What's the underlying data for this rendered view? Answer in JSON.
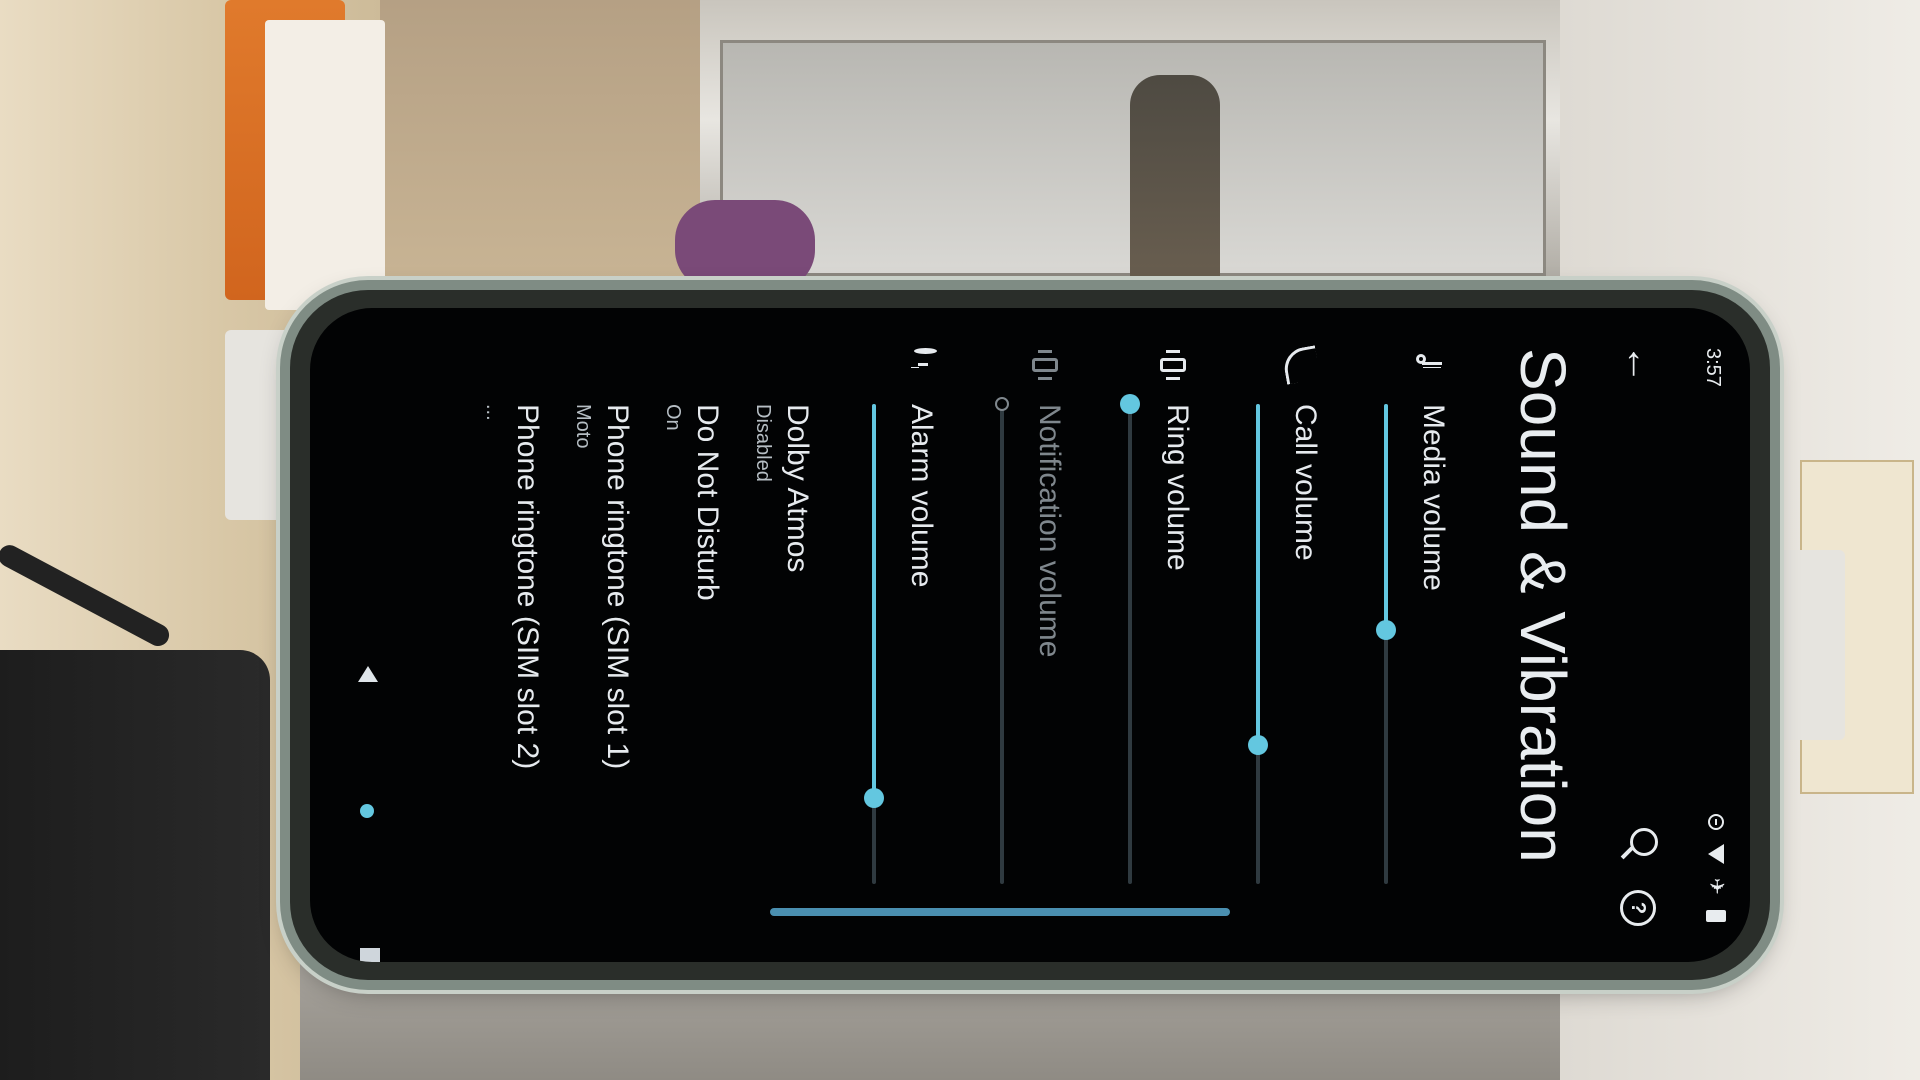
{
  "status_bar": {
    "time": "3:57",
    "icons": [
      "do-not-disturb-icon",
      "wifi-icon",
      "airplane-icon",
      "battery-icon"
    ]
  },
  "top_bar": {
    "back_icon": "arrow-back-icon",
    "search_icon": "search-icon",
    "help_icon": "help-icon"
  },
  "page": {
    "title": "Sound & Vibration"
  },
  "volumes": [
    {
      "label": "Media volume",
      "icon": "music-note-icon",
      "level": 0.47,
      "enabled": true
    },
    {
      "label": "Call volume",
      "icon": "phone-icon",
      "level": 0.71,
      "enabled": true
    },
    {
      "label": "Ring volume",
      "icon": "vibrate-icon",
      "level": 0.0,
      "enabled": true
    },
    {
      "label": "Notification volume",
      "icon": "vibrate-icon",
      "level": 0.0,
      "enabled": false
    },
    {
      "label": "Alarm volume",
      "icon": "alarm-icon",
      "level": 0.82,
      "enabled": true
    }
  ],
  "preferences": [
    {
      "title": "Dolby Atmos",
      "subtitle": "Disabled"
    },
    {
      "title": "Do Not Disturb",
      "subtitle": "On"
    },
    {
      "title": "Phone ringtone (SIM slot 1)",
      "subtitle": "Moto"
    },
    {
      "title": "Phone ringtone (SIM slot 2)",
      "subtitle": "..."
    }
  ],
  "colors": {
    "accent": "#63c7e0",
    "background": "#020304",
    "text": "#e6eaee",
    "nav_bar": "#4a8fb0"
  }
}
